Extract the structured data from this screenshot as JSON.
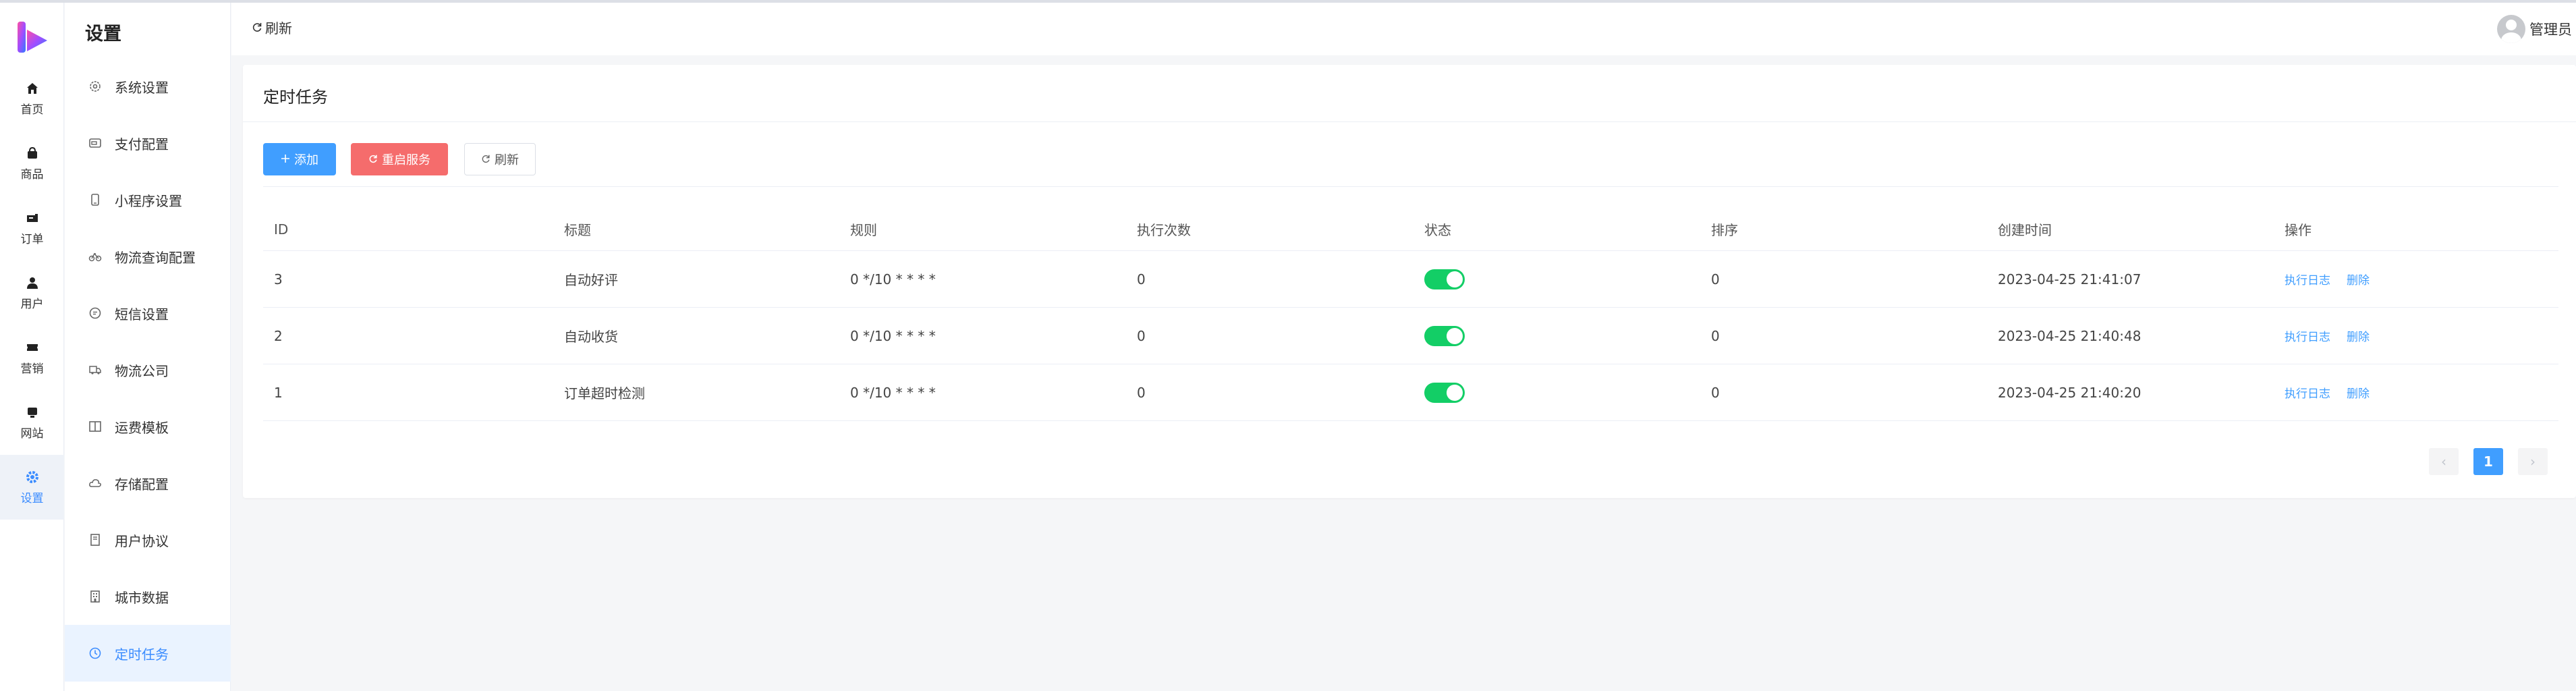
{
  "colors": {
    "accent": "#409eff",
    "danger": "#f56c6c",
    "switch_on": "#13ce66"
  },
  "nav": {
    "items": [
      {
        "label": "首页",
        "icon": "home-icon"
      },
      {
        "label": "商品",
        "icon": "bag-icon"
      },
      {
        "label": "订单",
        "icon": "ticket-icon"
      },
      {
        "label": "用户",
        "icon": "user-icon"
      },
      {
        "label": "营销",
        "icon": "coupon-icon"
      },
      {
        "label": "网站",
        "icon": "monitor-icon"
      },
      {
        "label": "设置",
        "icon": "gear-icon"
      }
    ],
    "active_index": 6
  },
  "sidebar": {
    "title": "设置",
    "items": [
      {
        "label": "系统设置",
        "icon": "settings-icon"
      },
      {
        "label": "支付配置",
        "icon": "wallet-icon"
      },
      {
        "label": "小程序设置",
        "icon": "phone-icon"
      },
      {
        "label": "物流查询配置",
        "icon": "bicycle-icon"
      },
      {
        "label": "短信设置",
        "icon": "chat-icon"
      },
      {
        "label": "物流公司",
        "icon": "truck-icon"
      },
      {
        "label": "运费模板",
        "icon": "book-icon"
      },
      {
        "label": "存储配置",
        "icon": "cloud-icon"
      },
      {
        "label": "用户协议",
        "icon": "document-icon"
      },
      {
        "label": "城市数据",
        "icon": "building-icon"
      },
      {
        "label": "定时任务",
        "icon": "clock-icon"
      }
    ],
    "active_index": 10
  },
  "header": {
    "refresh_label": "刷新",
    "user_name": "管理员"
  },
  "panel": {
    "title": "定时任务",
    "buttons": {
      "add": "添加",
      "restart": "重启服务",
      "refresh": "刷新"
    }
  },
  "table": {
    "columns": [
      "ID",
      "标题",
      "规则",
      "执行次数",
      "状态",
      "排序",
      "创建时间",
      "操作"
    ],
    "rows": [
      {
        "id": "3",
        "title": "自动好评",
        "rule": "0 */10 * * * *",
        "count": "0",
        "enabled": true,
        "sort": "0",
        "created": "2023-04-25 21:41:07",
        "action_log": "执行日志",
        "action_delete": "删除"
      },
      {
        "id": "2",
        "title": "自动收货",
        "rule": "0 */10 * * * *",
        "count": "0",
        "enabled": true,
        "sort": "0",
        "created": "2023-04-25 21:40:48",
        "action_log": "执行日志",
        "action_delete": "删除"
      },
      {
        "id": "1",
        "title": "订单超时检测",
        "rule": "0 */10 * * * *",
        "count": "0",
        "enabled": true,
        "sort": "0",
        "created": "2023-04-25 21:40:20",
        "action_log": "执行日志",
        "action_delete": "删除"
      }
    ]
  },
  "pagination": {
    "prev": "‹",
    "current": "1",
    "next": "›"
  }
}
